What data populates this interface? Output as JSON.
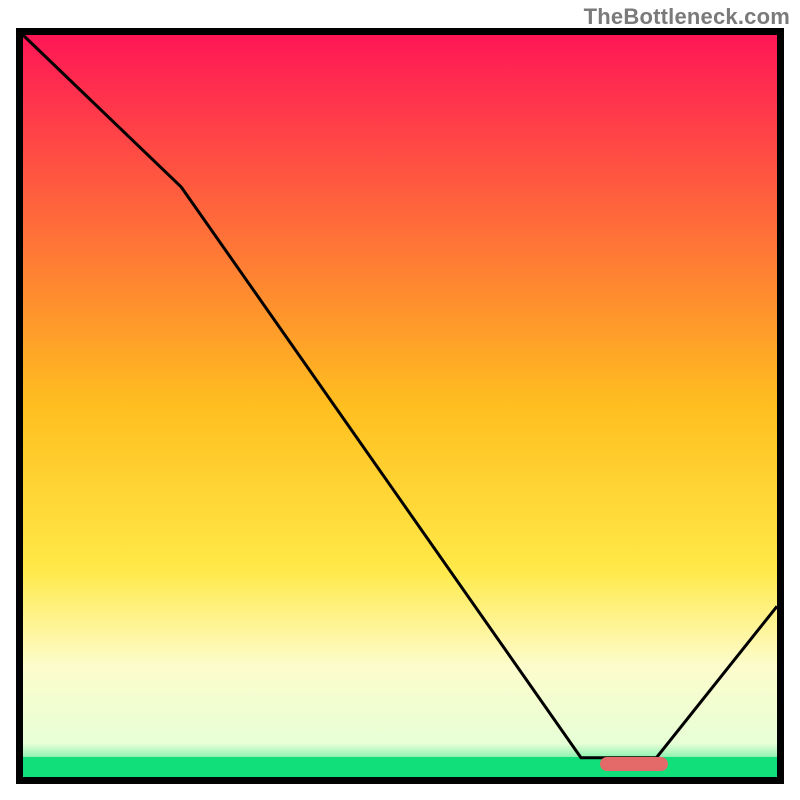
{
  "watermark": "TheBottleneck.com",
  "chart_data": {
    "type": "line",
    "title": "",
    "xlabel": "",
    "ylabel": "",
    "xlim": [
      0,
      100
    ],
    "ylim": [
      0,
      100
    ],
    "grid": false,
    "background_gradient_stops": [
      {
        "offset": 0,
        "color": "#ff1656"
      },
      {
        "offset": 0.25,
        "color": "#ff6a3a"
      },
      {
        "offset": 0.5,
        "color": "#ffbf1f"
      },
      {
        "offset": 0.72,
        "color": "#ffe948"
      },
      {
        "offset": 0.85,
        "color": "#fdfccc"
      },
      {
        "offset": 0.955,
        "color": "#e7ffd6"
      },
      {
        "offset": 1.0,
        "color": "#11e07a"
      }
    ],
    "green_band": {
      "y_start": 97.3,
      "y_end": 100,
      "color": "#11e07a"
    },
    "marker_segment": {
      "x_start": 76.5,
      "x_end": 85.5,
      "y": 98.2,
      "color": "#e46a6a"
    },
    "series": [
      {
        "name": "bottleneck-curve",
        "color": "#000000",
        "width": 3,
        "points": [
          {
            "x": 0.0,
            "y": 0.0
          },
          {
            "x": 21.0,
            "y": 20.5
          },
          {
            "x": 74.0,
            "y": 97.4
          },
          {
            "x": 84.0,
            "y": 97.4
          },
          {
            "x": 100.0,
            "y": 77.0
          }
        ]
      }
    ]
  }
}
